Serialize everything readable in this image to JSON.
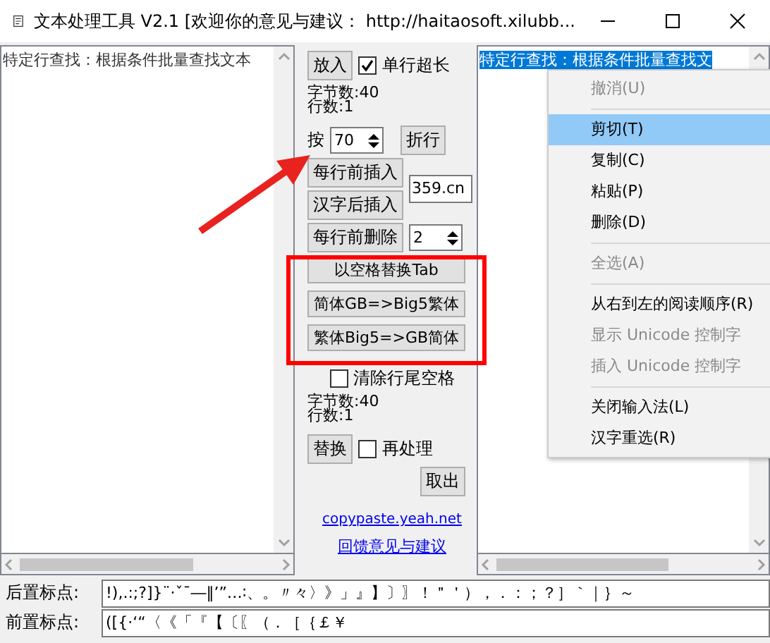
{
  "window": {
    "title": "文本处理工具 V2.1 [欢迎你的意见与建议： http://haitaosoft.xilubb..."
  },
  "source_text": {
    "value": "特定行查找：根据条件批量查找文本"
  },
  "tools": [
    {
      "kind": "row",
      "items": [
        {
          "kind": "button",
          "label": "放入"
        },
        {
          "kind": "checkbox",
          "label": "单行超长",
          "checked": true
        }
      ]
    },
    {
      "kind": "stats",
      "lines": [
        "字节数:40",
        "行数:1"
      ]
    },
    {
      "kind": "row",
      "items": [
        {
          "kind": "label",
          "text": "按"
        },
        {
          "kind": "spinner",
          "value": "70"
        },
        {
          "kind": "button",
          "label": "折行"
        }
      ]
    },
    {
      "kind": "row",
      "items": [
        {
          "kind": "stack",
          "items": [
            {
              "kind": "button",
              "label": "每行前插入"
            },
            {
              "kind": "button",
              "label": "汉字后插入"
            }
          ]
        },
        {
          "kind": "field",
          "value": "359.cn"
        }
      ]
    },
    {
      "kind": "row",
      "items": [
        {
          "kind": "button",
          "label": "每行前删除"
        },
        {
          "kind": "spinner",
          "value": "2"
        }
      ]
    },
    {
      "kind": "wide_button",
      "label": "以空格替换Tab"
    },
    {
      "kind": "wide_button",
      "label": "简体GB=>Big5繁体"
    },
    {
      "kind": "wide_button",
      "label": "繁体Big5=>GB简体"
    },
    {
      "kind": "checkbox",
      "label": "清除行尾空格",
      "checked": false
    },
    {
      "kind": "stats",
      "lines": [
        "字节数:40",
        "行数:1"
      ]
    },
    {
      "kind": "row",
      "items": [
        {
          "kind": "button",
          "label": "替换"
        },
        {
          "kind": "checkbox",
          "label": "再处理",
          "checked": false
        }
      ]
    },
    {
      "kind": "right_button",
      "label": "取出"
    },
    {
      "kind": "link",
      "text": "copypaste.yeah.net"
    },
    {
      "kind": "link",
      "text": "回馈意见与建议"
    }
  ],
  "result_text": {
    "selected_text": "特定行查找：根据条件批量查找文"
  },
  "context_menu": [
    {
      "kind": "item",
      "label": "撤消(U)",
      "disabled": true,
      "selected": false
    },
    {
      "kind": "separator"
    },
    {
      "kind": "item",
      "label": "剪切(T)",
      "disabled": false,
      "selected": true
    },
    {
      "kind": "item",
      "label": "复制(C)",
      "disabled": false,
      "selected": false
    },
    {
      "kind": "item",
      "label": "粘贴(P)",
      "disabled": false,
      "selected": false
    },
    {
      "kind": "item",
      "label": "删除(D)",
      "disabled": false,
      "selected": false
    },
    {
      "kind": "separator"
    },
    {
      "kind": "item",
      "label": "全选(A)",
      "disabled": true,
      "selected": false
    },
    {
      "kind": "separator"
    },
    {
      "kind": "item",
      "label": "从右到左的阅读顺序(R)",
      "disabled": false,
      "selected": false
    },
    {
      "kind": "item",
      "label": "显示 Unicode 控制字",
      "disabled": true,
      "selected": false
    },
    {
      "kind": "item",
      "label": "插入 Unicode 控制字",
      "disabled": true,
      "selected": false
    },
    {
      "kind": "separator"
    },
    {
      "kind": "item",
      "label": "关闭输入法(L)",
      "disabled": false,
      "selected": false
    },
    {
      "kind": "item",
      "label": "汉字重选(R)",
      "disabled": false,
      "selected": false
    }
  ],
  "punctuation": [
    {
      "label": "后置标点:",
      "value": "!),.:;?]}¨·ˇˉ―‖’”…∶、。〃々〉》」』】〕〗！＂＇），．：；？］｀｜｝～"
    },
    {
      "label": "前置标点:",
      "value": "([{·‘“〈《「『【〔〖（．［｛￡￥"
    }
  ]
}
